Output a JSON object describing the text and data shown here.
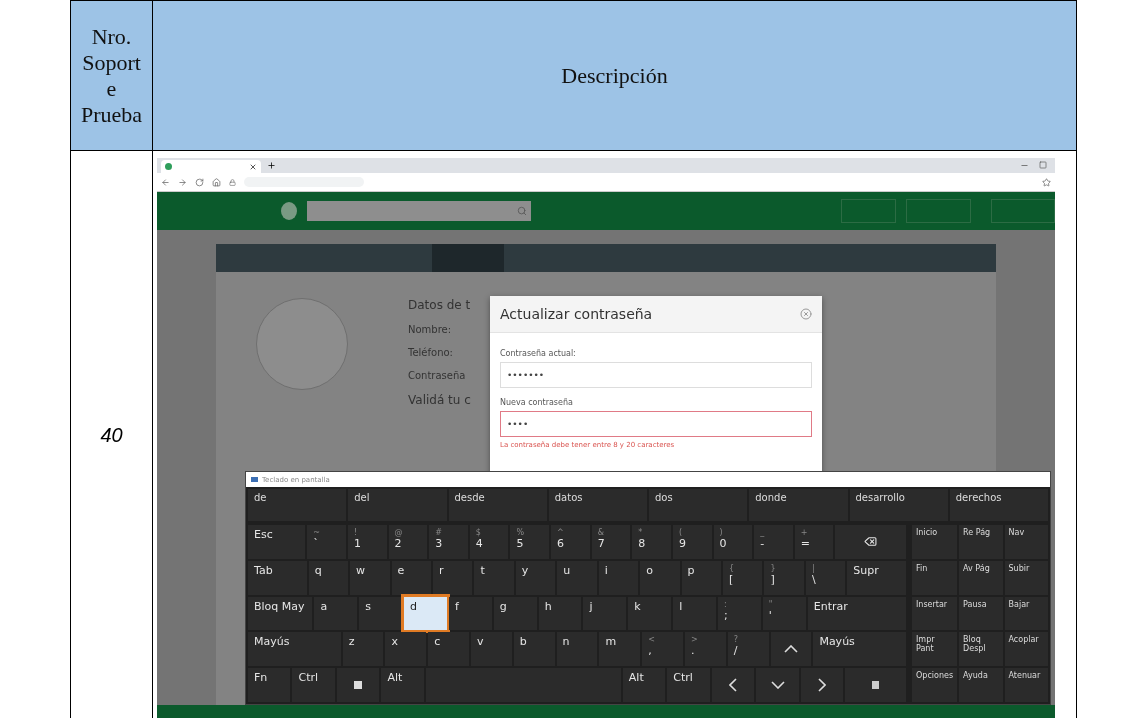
{
  "table": {
    "columns": [
      "Nro. Soporte Prueba",
      "Descripción"
    ],
    "rows": [
      {
        "number": "40",
        "screenshot": {
          "page": {
            "heading": "Datos de t",
            "fields": [
              "Nombre:",
              "Teléfono:",
              "Contraseña"
            ],
            "subheading": "Validá tu c"
          },
          "modal": {
            "title": "Actualizar contraseña",
            "fields": [
              {
                "label": "Contraseña actual:",
                "value": "•••••••",
                "error": false
              },
              {
                "label": "Nueva contraseña",
                "value": "••••",
                "error": true
              }
            ],
            "error_text": "La contraseña debe tener entre 8 y 20 caracteres"
          },
          "keyboard": {
            "title": "Teclado en pantalla",
            "suggestions": [
              "de",
              "del",
              "desde",
              "datos",
              "dos",
              "donde",
              "desarrollo",
              "derechos"
            ],
            "rows": [
              [
                {
                  "kind": "mod",
                  "label": "Esc",
                  "selected": false
                },
                {
                  "kind": "char",
                  "label": "`",
                  "shift": "~",
                  "selected": false
                },
                {
                  "kind": "char",
                  "label": "1",
                  "shift": "!",
                  "selected": false
                },
                {
                  "kind": "char",
                  "label": "2",
                  "shift": "@",
                  "selected": false
                },
                {
                  "kind": "char",
                  "label": "3",
                  "shift": "#",
                  "selected": false
                },
                {
                  "kind": "char",
                  "label": "4",
                  "shift": "$",
                  "selected": false
                },
                {
                  "kind": "char",
                  "label": "5",
                  "shift": "%",
                  "selected": false
                },
                {
                  "kind": "char",
                  "label": "6",
                  "shift": "^",
                  "selected": false
                },
                {
                  "kind": "char",
                  "label": "7",
                  "shift": "&",
                  "selected": false
                },
                {
                  "kind": "char",
                  "label": "8",
                  "shift": "*",
                  "selected": false
                },
                {
                  "kind": "char",
                  "label": "9",
                  "shift": "(",
                  "selected": false
                },
                {
                  "kind": "char",
                  "label": "0",
                  "shift": ")",
                  "selected": false
                },
                {
                  "kind": "char",
                  "label": "-",
                  "shift": "_",
                  "selected": false
                },
                {
                  "kind": "char",
                  "label": "=",
                  "shift": "+",
                  "selected": false
                },
                {
                  "kind": "backspace",
                  "selected": false
                }
              ],
              [
                {
                  "kind": "mod",
                  "label": "Tab",
                  "selected": false
                },
                {
                  "kind": "char",
                  "label": "q",
                  "selected": false
                },
                {
                  "kind": "char",
                  "label": "w",
                  "selected": false
                },
                {
                  "kind": "char",
                  "label": "e",
                  "selected": false
                },
                {
                  "kind": "char",
                  "label": "r",
                  "selected": false
                },
                {
                  "kind": "char",
                  "label": "t",
                  "selected": false
                },
                {
                  "kind": "char",
                  "label": "y",
                  "selected": false
                },
                {
                  "kind": "char",
                  "label": "u",
                  "selected": false
                },
                {
                  "kind": "char",
                  "label": "i",
                  "selected": false
                },
                {
                  "kind": "char",
                  "label": "o",
                  "selected": false
                },
                {
                  "kind": "char",
                  "label": "p",
                  "selected": false
                },
                {
                  "kind": "char",
                  "label": "[",
                  "shift": "{",
                  "selected": false
                },
                {
                  "kind": "char",
                  "label": "]",
                  "shift": "}",
                  "selected": false
                },
                {
                  "kind": "char",
                  "label": "\\",
                  "shift": "|",
                  "selected": false
                },
                {
                  "kind": "mod",
                  "label": "Supr",
                  "selected": false
                }
              ],
              [
                {
                  "kind": "mod",
                  "label": "Bloq May",
                  "selected": false
                },
                {
                  "kind": "char",
                  "label": "a",
                  "selected": false
                },
                {
                  "kind": "char",
                  "label": "s",
                  "selected": false
                },
                {
                  "kind": "char",
                  "label": "d",
                  "selected": true
                },
                {
                  "kind": "char",
                  "label": "f",
                  "selected": false
                },
                {
                  "kind": "char",
                  "label": "g",
                  "selected": false
                },
                {
                  "kind": "char",
                  "label": "h",
                  "selected": false
                },
                {
                  "kind": "char",
                  "label": "j",
                  "selected": false
                },
                {
                  "kind": "char",
                  "label": "k",
                  "selected": false
                },
                {
                  "kind": "char",
                  "label": "l",
                  "selected": false
                },
                {
                  "kind": "char",
                  "label": ";",
                  "shift": ":",
                  "selected": false
                },
                {
                  "kind": "char",
                  "label": "'",
                  "shift": "\"",
                  "selected": false
                },
                {
                  "kind": "wide",
                  "label": "Entrar",
                  "selected": false
                }
              ],
              [
                {
                  "kind": "wide",
                  "label": "Mayús",
                  "selected": false
                },
                {
                  "kind": "char",
                  "label": "z",
                  "selected": false
                },
                {
                  "kind": "char",
                  "label": "x",
                  "selected": false
                },
                {
                  "kind": "char",
                  "label": "c",
                  "selected": false
                },
                {
                  "kind": "char",
                  "label": "v",
                  "selected": false
                },
                {
                  "kind": "char",
                  "label": "b",
                  "selected": false
                },
                {
                  "kind": "char",
                  "label": "n",
                  "selected": false
                },
                {
                  "kind": "char",
                  "label": "m",
                  "selected": false
                },
                {
                  "kind": "char",
                  "label": ",",
                  "shift": "<",
                  "selected": false
                },
                {
                  "kind": "char",
                  "label": ".",
                  "shift": ">",
                  "selected": false
                },
                {
                  "kind": "char",
                  "label": "/",
                  "shift": "?",
                  "selected": false
                },
                {
                  "kind": "up",
                  "selected": false
                },
                {
                  "kind": "wide",
                  "label": "Mayús",
                  "selected": false
                }
              ],
              [
                {
                  "kind": "char",
                  "label": "Fn",
                  "selected": false
                },
                {
                  "kind": "char",
                  "label": "Ctrl",
                  "selected": false
                },
                {
                  "kind": "windows",
                  "selected": false
                },
                {
                  "kind": "char",
                  "label": "Alt",
                  "selected": false
                },
                {
                  "kind": "space",
                  "selected": false
                },
                {
                  "kind": "char",
                  "label": "Alt",
                  "selected": false
                },
                {
                  "kind": "char",
                  "label": "Ctrl",
                  "selected": false
                },
                {
                  "kind": "left",
                  "selected": false
                },
                {
                  "kind": "down",
                  "selected": false
                },
                {
                  "kind": "right",
                  "selected": false
                },
                {
                  "kind": "menu",
                  "selected": false
                }
              ]
            ],
            "nav_keys": [
              [
                "Inicio",
                "Re Pág",
                "Nav"
              ],
              [
                "Fin",
                "Av Pág",
                "Subir"
              ],
              [
                "Insertar",
                "Pausa",
                "Bajar"
              ],
              [
                "Impr Pant",
                "Bloq Despl",
                "Acoplar"
              ],
              [
                "Opciones",
                "Ayuda",
                "Atenuar"
              ]
            ]
          }
        }
      }
    ]
  }
}
